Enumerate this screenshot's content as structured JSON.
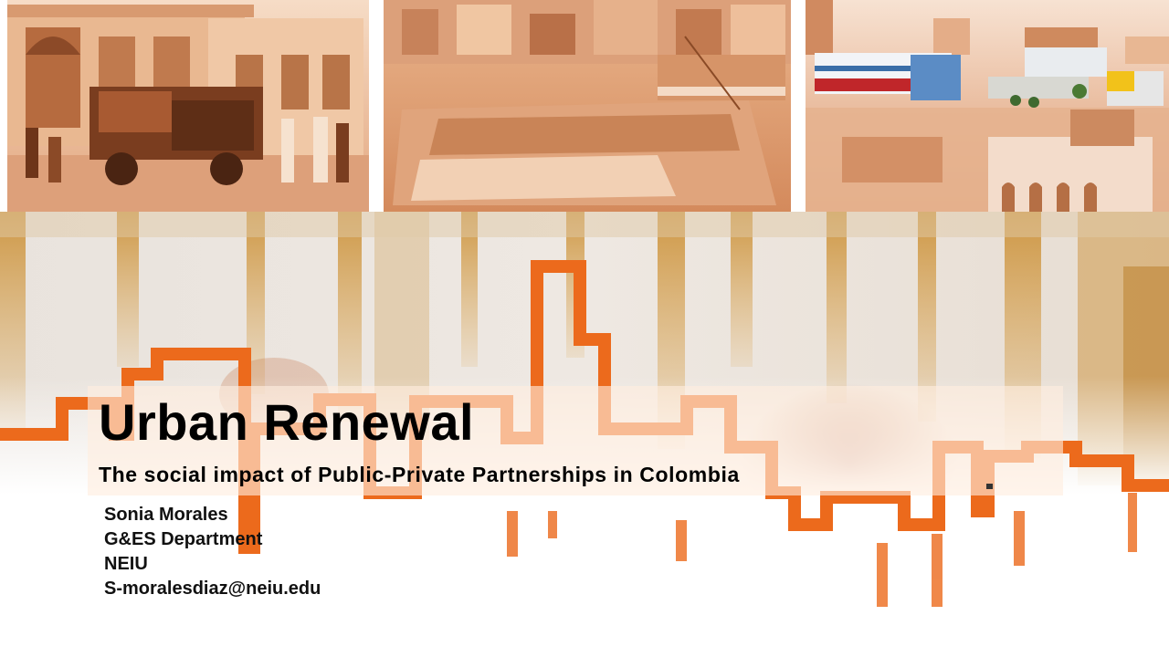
{
  "slide": {
    "title": "Urban Renewal",
    "subtitle": "The social impact of Public-Private Partnerships in Colombia",
    "author": {
      "name": "Sonia Morales",
      "department": "G&ES Department",
      "institution": "NEIU",
      "email": "S-moralesdiaz@neiu.edu"
    }
  },
  "colors": {
    "accent": "#ec6a1c",
    "sepia_dark": "#8a4a26",
    "sepia_light": "#f3c9a8",
    "stain": "#c98a2a"
  },
  "images": [
    "historic-street-photo",
    "construction-site-photo",
    "modern-city-photo"
  ]
}
